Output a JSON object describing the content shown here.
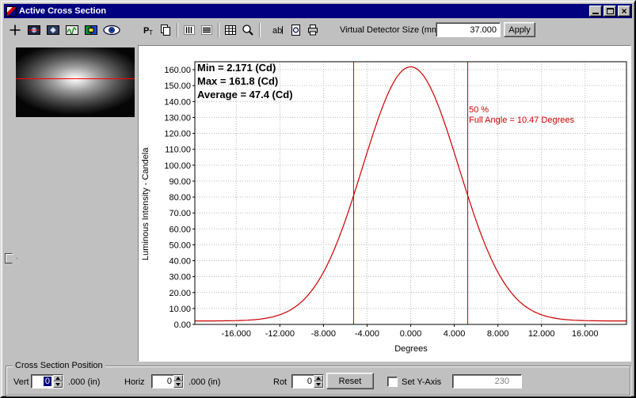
{
  "window": {
    "title": "Active Cross Section",
    "close_glyph": "×"
  },
  "toolbar": {
    "icons_left": [
      "crosshair-icon",
      "camera-image-icon",
      "overlay-icon",
      "fringe-icon",
      "palette-icon",
      "eye-icon"
    ],
    "icons_main": [
      "profile-icon",
      "copy-icon",
      "columns-icon",
      "rows-icon",
      "grid-icon",
      "zoom-icon",
      "annotate-icon",
      "preview-icon",
      "print-icon"
    ],
    "icon_glyphs": {
      "profile": "P",
      "profile_sub": "T",
      "annotate": "ab"
    },
    "detector_label": "Virtual Detector Size (mm)",
    "detector_value": "37.000",
    "apply_label": "Apply"
  },
  "chart": {
    "annotations": {
      "min": "Min = 2.171 (Cd)",
      "max": "Max = 161.8 (Cd)",
      "average": "Average = 47.4 (Cd)",
      "pct": "50 %",
      "full_angle": "Full Angle = 10.47 Degrees"
    },
    "ylabel": "Luminous Intensity - Candela",
    "xlabel": "Degrees"
  },
  "chart_data": {
    "type": "line",
    "xlabel": "Degrees",
    "ylabel": "Luminous Intensity - Candela",
    "xlim": [
      -19.8,
      19.8
    ],
    "ylim": [
      0,
      165
    ],
    "x_ticks": [
      -16,
      -12,
      -8,
      -4,
      0,
      4,
      8,
      12,
      16
    ],
    "x_tick_labels": [
      "-16.000",
      "-12.000",
      "-8.000",
      "-4.000",
      "0.000",
      "4.000",
      "8.000",
      "12.000",
      "16.000"
    ],
    "y_ticks": [
      0,
      10,
      20,
      30,
      40,
      50,
      60,
      70,
      80,
      90,
      100,
      110,
      120,
      130,
      140,
      150,
      160
    ],
    "y_tick_labels": [
      "0.00",
      "10.00",
      "20.00",
      "30.00",
      "40.00",
      "50.00",
      "60.00",
      "70.00",
      "80.00",
      "90.00",
      "100.00",
      "110.00",
      "120.00",
      "130.00",
      "140.00",
      "150.00",
      "160.00"
    ],
    "curve": {
      "shape": "gaussian",
      "center": 0,
      "peak": 161.8,
      "min": 2.171,
      "fwhm_deg": 10.47
    },
    "marker_lines_deg": [
      -5.235,
      5.235
    ],
    "series_color": "#cc0000",
    "grid": true,
    "stats": {
      "min_cd": 2.171,
      "max_cd": 161.8,
      "average_cd": 47.4,
      "half_max_pct": 50,
      "full_angle_deg": 10.47
    }
  },
  "bottom": {
    "group_label": "Cross Section Position",
    "vert": {
      "label": "Vert",
      "value": "0",
      "unit": ".000 (in)"
    },
    "horiz": {
      "label": "Horiz",
      "value": "0",
      "unit": ".000 (in)"
    },
    "rot": {
      "label": "Rot",
      "value": "0"
    },
    "reset_label": "Reset",
    "set_y_axis_label": "Set Y-Axis",
    "y_axis_value": "230"
  }
}
